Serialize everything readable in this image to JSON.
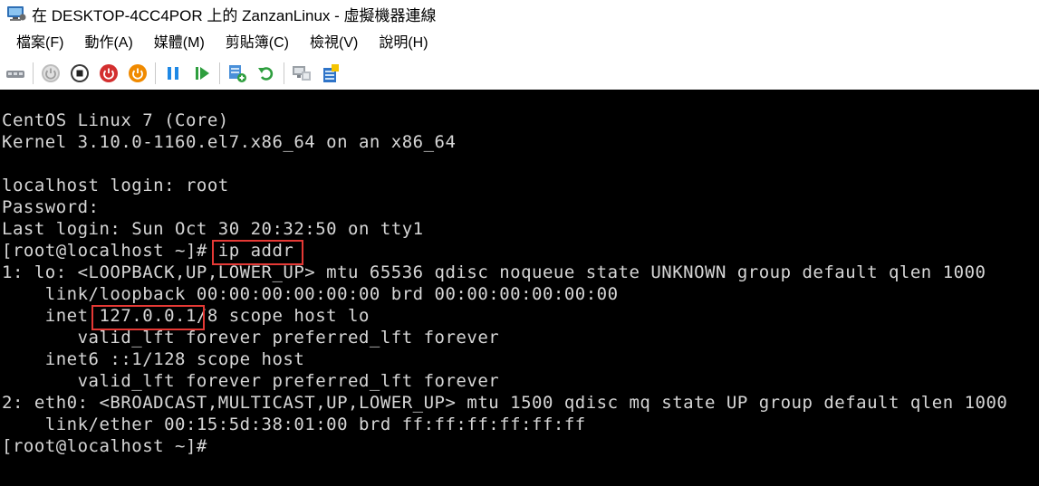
{
  "window": {
    "title": "在 DESKTOP-4CC4POR 上的 ZanzanLinux - 虛擬機器連線"
  },
  "menu": {
    "items": [
      {
        "label": "檔案(F)"
      },
      {
        "label": "動作(A)"
      },
      {
        "label": "媒體(M)"
      },
      {
        "label": "剪貼簿(C)"
      },
      {
        "label": "檢視(V)"
      },
      {
        "label": "說明(H)"
      }
    ]
  },
  "toolbar": {
    "buttons": [
      {
        "icon": "ctrl-alt-del-icon"
      },
      {
        "icon": "start-icon"
      },
      {
        "icon": "turn-off-icon"
      },
      {
        "icon": "shutdown-icon"
      },
      {
        "icon": "save-icon"
      },
      {
        "icon": "pause-icon"
      },
      {
        "icon": "resume-icon"
      },
      {
        "icon": "checkpoint-icon"
      },
      {
        "icon": "revert-icon"
      },
      {
        "icon": "enhanced-session-icon"
      },
      {
        "icon": "share-icon"
      }
    ],
    "colors": {
      "gray": "#9e9e9e",
      "red": "#d32f2f",
      "orange": "#f08a00",
      "blue": "#1e88e5",
      "green": "#2e9e3e"
    }
  },
  "console": {
    "lines": [
      "CentOS Linux 7 (Core)",
      "Kernel 3.10.0-1160.el7.x86_64 on an x86_64",
      "",
      "localhost login: root",
      "Password:",
      "Last login: Sun Oct 30 20:32:50 on tty1",
      "[root@localhost ~]# ip addr",
      "1: lo: <LOOPBACK,UP,LOWER_UP> mtu 65536 qdisc noqueue state UNKNOWN group default qlen 1000",
      "    link/loopback 00:00:00:00:00:00 brd 00:00:00:00:00:00",
      "    inet 127.0.0.1/8 scope host lo",
      "       valid_lft forever preferred_lft forever",
      "    inet6 ::1/128 scope host",
      "       valid_lft forever preferred_lft forever",
      "2: eth0: <BROADCAST,MULTICAST,UP,LOWER_UP> mtu 1500 qdisc mq state UP group default qlen 1000",
      "    link/ether 00:15:5d:38:01:00 brd ff:ff:ff:ff:ff:ff",
      "[root@localhost ~]#"
    ],
    "highlight_color": "#e53935"
  }
}
